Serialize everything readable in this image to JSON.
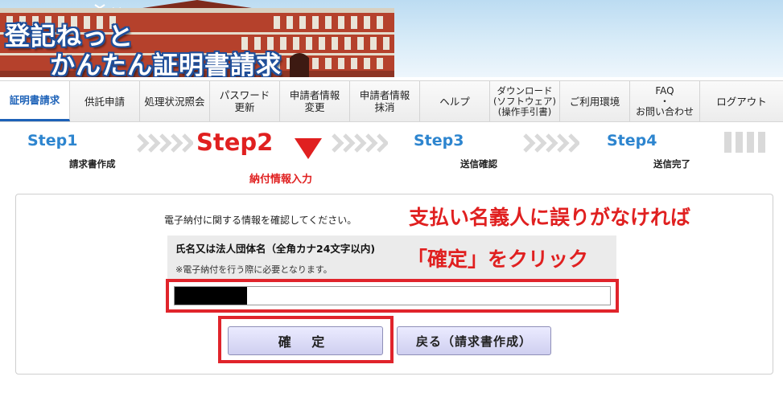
{
  "banner": {
    "title_line1": "登記ねっと",
    "title_line2": "かんたん証明書請求"
  },
  "nav": {
    "items": [
      {
        "label": "証明書請求",
        "active": true
      },
      {
        "label": "供託申請"
      },
      {
        "label": "処理状況照会"
      },
      {
        "label": "パスワード\n更新"
      },
      {
        "label": "申請者情報\n変更"
      },
      {
        "label": "申請者情報\n抹消"
      },
      {
        "label": "ヘルプ"
      },
      {
        "label": "ダウンロード\n(ソフトウェア)\n(操作手引書)"
      },
      {
        "label": "ご利用環境"
      },
      {
        "label": "FAQ\n・\nお問い合わせ"
      },
      {
        "label": "ログアウト"
      }
    ]
  },
  "steps": [
    {
      "title": "Step1",
      "label": "請求書作成"
    },
    {
      "title": "Step2",
      "label": "納付情報入力",
      "current": true
    },
    {
      "title": "Step3",
      "label": "送信確認"
    },
    {
      "title": "Step4",
      "label": "送信完了"
    }
  ],
  "form": {
    "instruction": "電子納付に関する情報を確認してください。",
    "name_label": "氏名又は法人団体名（全角カナ24文字以内)",
    "name_note": "※電子納付を行う際に必要となります。",
    "name_value": ""
  },
  "buttons": {
    "confirm": "確 定",
    "back": "戻る（請求書作成）"
  },
  "annotations": {
    "line1": "支払い名義人に誤りがなければ",
    "line2": "「確定」をクリック"
  },
  "colors": {
    "accent_blue": "#2d85cf",
    "highlight_red": "#e02020"
  }
}
